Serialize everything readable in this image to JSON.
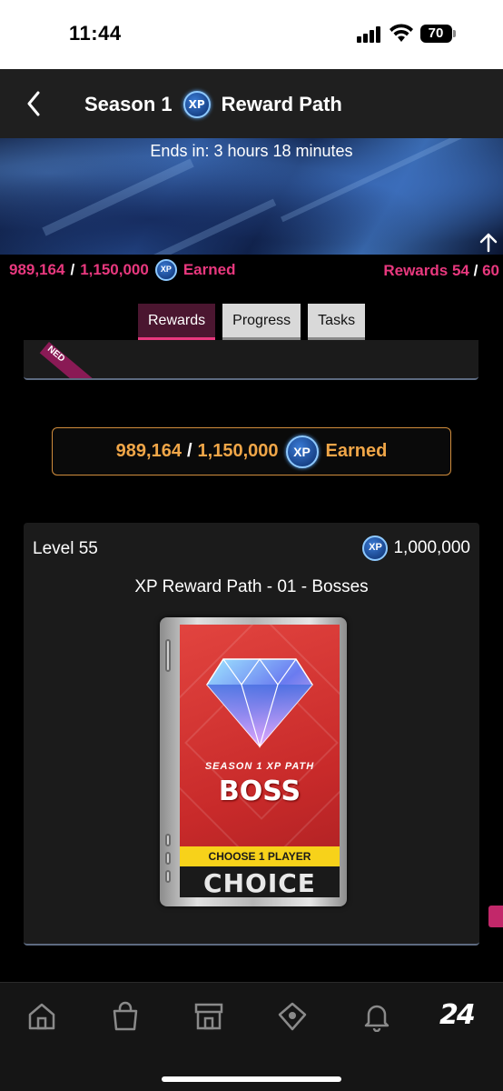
{
  "status_bar": {
    "time": "11:44",
    "battery": "70"
  },
  "header": {
    "title_prefix": "Season 1",
    "xp_badge": "XP",
    "title_suffix": "Reward Path"
  },
  "banner": {
    "text": "Ends in: 3 hours 18 minutes"
  },
  "earned_row": {
    "current": "989,164",
    "separator": "/",
    "total": "1,150,000",
    "xp_badge": "XP",
    "earned_label": "Earned",
    "rewards_label": "Rewards",
    "rewards_current": "54",
    "rewards_total": "60"
  },
  "tabs": [
    {
      "label": "Rewards",
      "active": true
    },
    {
      "label": "Progress",
      "active": false
    },
    {
      "label": "Tasks",
      "active": false
    }
  ],
  "partial_card": {
    "ribbon_text": "NED"
  },
  "earned_box": {
    "current": "989,164",
    "separator": "/",
    "total": "1,150,000",
    "xp_badge": "XP",
    "earned_label": "Earned"
  },
  "level_card": {
    "level": "Level 55",
    "xp_badge": "XP",
    "xp_amount": "1,000,000",
    "title": "XP Reward Path - 01 - Bosses",
    "pack": {
      "subtitle": "SEASON 1 XP PATH",
      "name": "BOSS",
      "banner": "CHOOSE 1 PLAYER",
      "footer": "CHOICE"
    }
  },
  "bottom_nav": {
    "items": [
      {
        "icon": "home-icon"
      },
      {
        "icon": "shopping-bag-icon"
      },
      {
        "icon": "store-icon"
      },
      {
        "icon": "baseball-diamond-icon"
      },
      {
        "icon": "bell-icon"
      },
      {
        "icon": "mlb-24-logo-icon",
        "label": "24"
      }
    ]
  },
  "colors": {
    "accent_pink": "#e8387e",
    "gold": "#f0a648",
    "background": "#000000",
    "header_bg": "#1f1f1f"
  }
}
